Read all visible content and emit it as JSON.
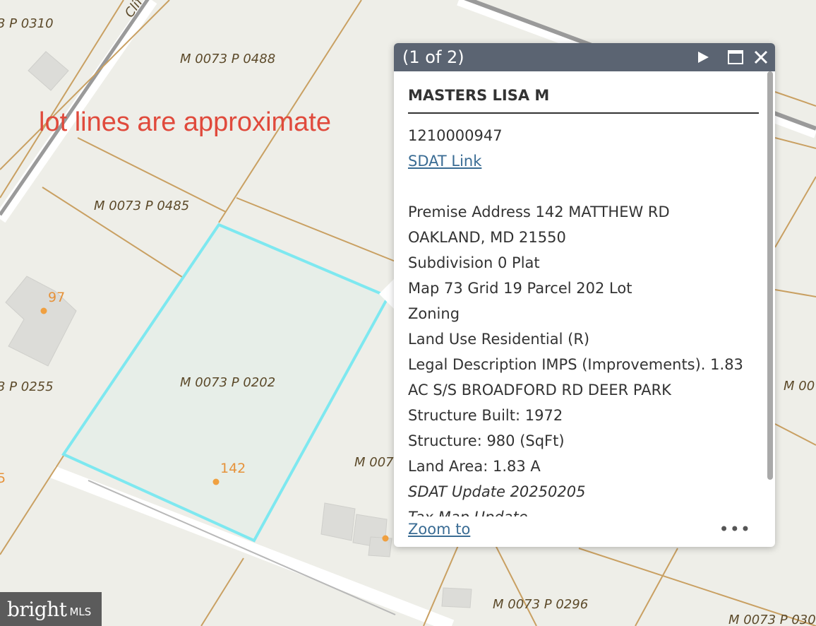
{
  "map": {
    "note": "lot lines are approximate",
    "parcel_labels": [
      "3 P 0310",
      "M 0073 P 0488",
      "M 0073 P 0485",
      "3 P 0255",
      "M 0073 P 0202",
      "M 007",
      "M 00",
      "M 0073 P 0296",
      "M 0073 P 030"
    ],
    "address_labels": [
      "97",
      "142",
      "5"
    ],
    "road_label": "Clif",
    "highlight_color": "#7ee8f0",
    "lot_line_color": "#c9a062"
  },
  "popup": {
    "title": "(1 of 2)",
    "owner": "MASTERS LISA M",
    "account": "1210000947",
    "sdat_link": "SDAT Link",
    "lines": [
      "Premise Address 142 MATTHEW RD",
      "OAKLAND, MD 21550",
      "Subdivision 0 Plat",
      "Map 73 Grid 19 Parcel 202 Lot",
      "Zoning",
      "Land Use Residential (R)",
      "Legal Description IMPS (Improvements). 1.83",
      "AC S/S BROADFORD RD DEER PARK",
      "Structure Built: 1972",
      "Structure: 980 (SqFt)",
      "Land Area: 1.83 A"
    ],
    "sdat_update": "SDAT Update 20250205",
    "tax_map_update": "Tax Map Update",
    "zoom_to": "Zoom to",
    "more": "•••",
    "header_color": "#5b6472"
  },
  "logo": {
    "main": "bright",
    "sub": "MLS"
  }
}
